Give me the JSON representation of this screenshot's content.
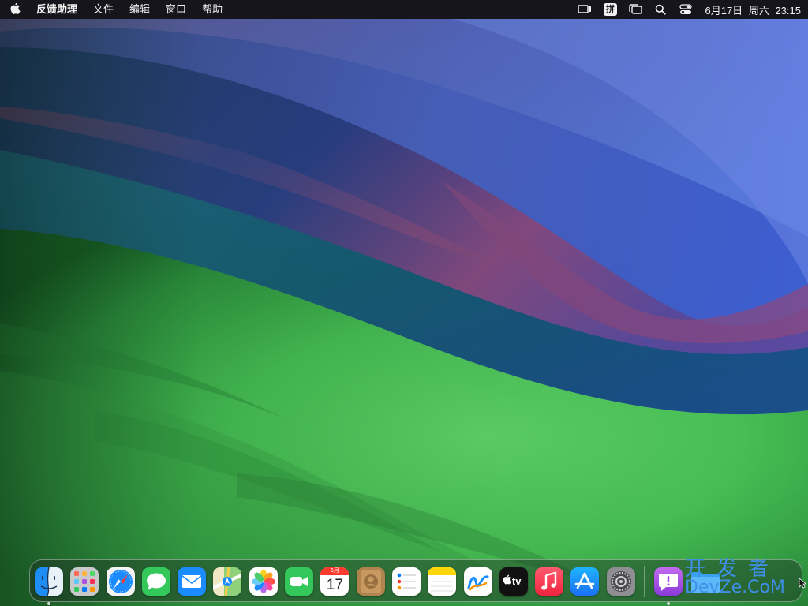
{
  "menubar": {
    "app_name": "反馈助理",
    "menus": [
      "文件",
      "编辑",
      "窗口",
      "帮助"
    ],
    "input_method": "拼",
    "date": "6月17日",
    "weekday": "周六",
    "time": "23:15",
    "status_icons": [
      "screen-mirroring-icon",
      "input-method-icon",
      "stage-manager-icon",
      "spotlight-search-icon",
      "control-center-icon"
    ]
  },
  "dock": {
    "apps": [
      {
        "name": "Finder",
        "icon": "finder-icon",
        "running": true
      },
      {
        "name": "Launchpad",
        "icon": "launchpad-icon",
        "running": false
      },
      {
        "name": "Safari",
        "icon": "safari-icon",
        "running": false
      },
      {
        "name": "Messages",
        "icon": "messages-icon",
        "running": false
      },
      {
        "name": "Mail",
        "icon": "mail-icon",
        "running": false
      },
      {
        "name": "Maps",
        "icon": "maps-icon",
        "running": false
      },
      {
        "name": "Photos",
        "icon": "photos-icon",
        "running": false
      },
      {
        "name": "FaceTime",
        "icon": "facetime-icon",
        "running": false
      },
      {
        "name": "Calendar",
        "icon": "calendar-icon",
        "running": false,
        "month": "6月",
        "day": "17"
      },
      {
        "name": "Contacts",
        "icon": "contacts-icon",
        "running": false
      },
      {
        "name": "Reminders",
        "icon": "reminders-icon",
        "running": false
      },
      {
        "name": "Notes",
        "icon": "notes-icon",
        "running": false
      },
      {
        "name": "Freeform",
        "icon": "freeform-icon",
        "running": false
      },
      {
        "name": "TV",
        "icon": "apple-tv-icon",
        "running": false,
        "label": "tv"
      },
      {
        "name": "Music",
        "icon": "music-icon",
        "running": false
      },
      {
        "name": "App Store",
        "icon": "app-store-icon",
        "running": false
      },
      {
        "name": "System Settings",
        "icon": "system-settings-icon",
        "running": false
      },
      {
        "name": "Feedback Assistant",
        "icon": "feedback-assistant-icon",
        "running": true
      }
    ],
    "trailing": [
      "downloads-folder-icon",
      "trash-icon"
    ]
  },
  "watermark": {
    "line1": "开发者",
    "line2": "DevZe.CoM"
  },
  "colors": {
    "menubar_bg": "#15151b",
    "accent_blue": "#3f8fe8"
  }
}
